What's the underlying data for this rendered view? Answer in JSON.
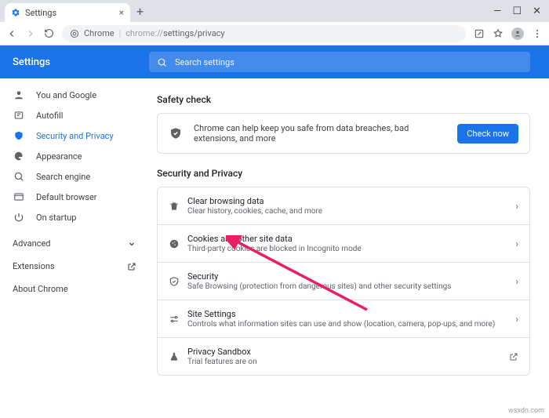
{
  "window": {
    "tab_title": "Settings",
    "min": "—",
    "max": "☐",
    "close": "✕"
  },
  "addr": {
    "app": "Chrome",
    "url_dim": "chrome://",
    "url_path": "settings/privacy"
  },
  "header": {
    "title": "Settings",
    "search_placeholder": "Search settings"
  },
  "sidebar": {
    "items": [
      {
        "label": "You and Google"
      },
      {
        "label": "Autofill"
      },
      {
        "label": "Security and Privacy"
      },
      {
        "label": "Appearance"
      },
      {
        "label": "Search engine"
      },
      {
        "label": "Default browser"
      },
      {
        "label": "On startup"
      }
    ],
    "advanced": "Advanced",
    "extensions": "Extensions",
    "about": "About Chrome"
  },
  "safety": {
    "title": "Safety check",
    "desc": "Chrome can help keep you safe from data breaches, bad extensions, and more",
    "button": "Check now"
  },
  "sp": {
    "title": "Security and Privacy",
    "rows": [
      {
        "title": "Clear browsing data",
        "sub": "Clear history, cookies, cache, and more"
      },
      {
        "title": "Cookies and other site data",
        "sub": "Third-party cookies are blocked in Incognito mode"
      },
      {
        "title": "Security",
        "sub": "Safe Browsing (protection from dangerous sites) and other security settings"
      },
      {
        "title": "Site Settings",
        "sub": "Controls what information sites can use and show (location, camera, pop-ups, and more)"
      },
      {
        "title": "Privacy Sandbox",
        "sub": "Trial features are on"
      }
    ]
  },
  "watermark": "wsxdn.com"
}
